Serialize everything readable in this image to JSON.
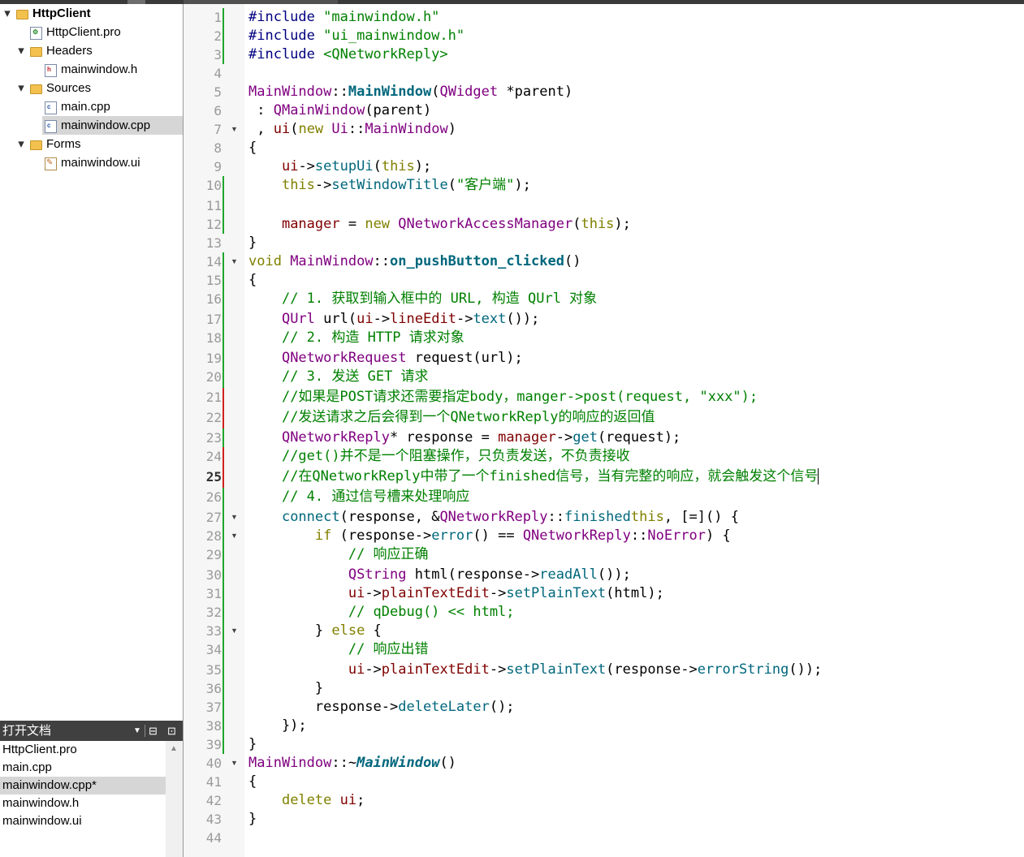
{
  "project_tree": [
    {
      "label": "HttpClient",
      "indent": 0,
      "arrow": "down",
      "icon": "project",
      "bold": true
    },
    {
      "label": "HttpClient.pro",
      "indent": 1,
      "arrow": "",
      "icon": "pro-file"
    },
    {
      "label": "Headers",
      "indent": 1,
      "arrow": "down",
      "icon": "folder"
    },
    {
      "label": "mainwindow.h",
      "indent": 2,
      "arrow": "",
      "icon": "header-file"
    },
    {
      "label": "Sources",
      "indent": 1,
      "arrow": "down",
      "icon": "folder"
    },
    {
      "label": "main.cpp",
      "indent": 2,
      "arrow": "",
      "icon": "cpp-file"
    },
    {
      "label": "mainwindow.cpp",
      "indent": 2,
      "arrow": "",
      "icon": "cpp-file",
      "selected": true
    },
    {
      "label": "Forms",
      "indent": 1,
      "arrow": "down",
      "icon": "folder"
    },
    {
      "label": "mainwindow.ui",
      "indent": 2,
      "arrow": "",
      "icon": "ui-file"
    }
  ],
  "open_documents": {
    "title": "打开文档",
    "items": [
      "HttpClient.pro",
      "main.cpp",
      "mainwindow.cpp*",
      "mainwindow.h",
      "mainwindow.ui"
    ],
    "selected_index": 2
  },
  "editor": {
    "current_line": 25,
    "lines": [
      {
        "n": "1",
        "tokens": [
          [
            "pp",
            "#include "
          ],
          [
            "s",
            "\"mainwindow.h\""
          ]
        ],
        "chg": "green"
      },
      {
        "n": "2",
        "tokens": [
          [
            "pp",
            "#include "
          ],
          [
            "s",
            "\"ui_mainwindow.h\""
          ]
        ],
        "chg": "green"
      },
      {
        "n": "3",
        "tokens": [
          [
            "pp",
            "#include "
          ],
          [
            "s",
            "<QNetworkReply>"
          ]
        ],
        "chg": "green"
      },
      {
        "n": "4",
        "tokens": []
      },
      {
        "n": "5",
        "tokens": [
          [
            "t",
            "MainWindow"
          ],
          [
            "",
            "::"
          ],
          [
            "fb",
            "MainWindow"
          ],
          [
            "",
            "("
          ],
          [
            "t",
            "QWidget"
          ],
          [
            "",
            " *parent)"
          ]
        ]
      },
      {
        "n": "6",
        "tokens": [
          [
            "",
            " : "
          ],
          [
            "t",
            "QMainWindow"
          ],
          [
            "",
            "(parent)"
          ]
        ]
      },
      {
        "n": "7",
        "tokens": [
          [
            "",
            " , "
          ],
          [
            "m",
            "ui"
          ],
          [
            "",
            "("
          ],
          [
            "k",
            "new "
          ],
          [
            "t",
            "Ui"
          ],
          [
            "",
            "::"
          ],
          [
            "t",
            "MainWindow"
          ],
          [
            "",
            ")"
          ]
        ],
        "fold": true
      },
      {
        "n": "8",
        "tokens": [
          [
            "",
            "{"
          ]
        ]
      },
      {
        "n": "9",
        "tokens": [
          [
            "",
            "    "
          ],
          [
            "m",
            "ui"
          ],
          [
            "",
            "->"
          ],
          [
            "f",
            "setupUi"
          ],
          [
            "",
            "("
          ],
          [
            "k",
            "this"
          ],
          [
            "",
            ");"
          ]
        ]
      },
      {
        "n": "10",
        "tokens": [
          [
            "",
            "    "
          ],
          [
            "k",
            "this"
          ],
          [
            "",
            "->"
          ],
          [
            "f",
            "setWindowTitle"
          ],
          [
            "",
            "("
          ],
          [
            "s",
            "\"客户端\""
          ],
          [
            "",
            ");"
          ]
        ],
        "chg": "green"
      },
      {
        "n": "11",
        "tokens": [],
        "chg": "green"
      },
      {
        "n": "12",
        "tokens": [
          [
            "",
            "    "
          ],
          [
            "m",
            "manager"
          ],
          [
            "",
            " = "
          ],
          [
            "k",
            "new "
          ],
          [
            "t",
            "QNetworkAccessManager"
          ],
          [
            "",
            "("
          ],
          [
            "k",
            "this"
          ],
          [
            "",
            ");"
          ]
        ],
        "chg": "green"
      },
      {
        "n": "13",
        "tokens": [
          [
            "",
            "}"
          ]
        ]
      },
      {
        "n": "14",
        "tokens": [
          [
            "k",
            "void "
          ],
          [
            "t",
            "MainWindow"
          ],
          [
            "",
            "::"
          ],
          [
            "fb",
            "on_pushButton_clicked"
          ],
          [
            "",
            "()"
          ]
        ],
        "fold": true,
        "chg": "green"
      },
      {
        "n": "15",
        "tokens": [
          [
            "",
            "{"
          ]
        ],
        "chg": "green"
      },
      {
        "n": "16",
        "tokens": [
          [
            "",
            "    "
          ],
          [
            "c",
            "// 1. 获取到输入框中的 URL, 构造 QUrl 对象"
          ]
        ],
        "chg": "green"
      },
      {
        "n": "17",
        "tokens": [
          [
            "",
            "    "
          ],
          [
            "t",
            "QUrl"
          ],
          [
            "",
            " url("
          ],
          [
            "m",
            "ui"
          ],
          [
            "",
            "->"
          ],
          [
            "m",
            "lineEdit"
          ],
          [
            "",
            "->"
          ],
          [
            "f",
            "text"
          ],
          [
            "",
            "());"
          ]
        ],
        "chg": "green"
      },
      {
        "n": "18",
        "tokens": [
          [
            "",
            "    "
          ],
          [
            "c",
            "// 2. 构造 HTTP 请求对象"
          ]
        ],
        "chg": "green"
      },
      {
        "n": "19",
        "tokens": [
          [
            "",
            "    "
          ],
          [
            "t",
            "QNetworkRequest"
          ],
          [
            "",
            " request(url);"
          ]
        ],
        "chg": "green"
      },
      {
        "n": "20",
        "tokens": [
          [
            "",
            "    "
          ],
          [
            "c",
            "// 3. 发送 GET 请求"
          ]
        ],
        "chg": "green"
      },
      {
        "n": "21",
        "tokens": [
          [
            "",
            "    "
          ],
          [
            "c",
            "//如果是POST请求还需要指定body，manger->post(request, \"xxx\");"
          ]
        ],
        "chg": "red"
      },
      {
        "n": "22",
        "tokens": [
          [
            "",
            "    "
          ],
          [
            "c",
            "//发送请求之后会得到一个QNetworkReply的响应的返回值"
          ]
        ],
        "chg": "red"
      },
      {
        "n": "23",
        "tokens": [
          [
            "",
            "    "
          ],
          [
            "t",
            "QNetworkReply"
          ],
          [
            "",
            "* response = "
          ],
          [
            "m",
            "manager"
          ],
          [
            "",
            "->"
          ],
          [
            "f",
            "get"
          ],
          [
            "",
            "(request);"
          ]
        ],
        "chg": "green"
      },
      {
        "n": "24",
        "tokens": [
          [
            "",
            "    "
          ],
          [
            "c",
            "//get()并不是一个阻塞操作，只负责发送，不负责接收"
          ]
        ],
        "chg": "red"
      },
      {
        "n": "25",
        "tokens": [
          [
            "",
            "    "
          ],
          [
            "c",
            "//在QNetworkReply中带了一个finished信号，当有完整的响应，就会触发这个信号"
          ]
        ],
        "chg": "red",
        "cursor": true
      },
      {
        "n": "26",
        "tokens": [
          [
            "",
            "    "
          ],
          [
            "c",
            "// 4. 通过信号槽来处理响应"
          ]
        ],
        "chg": "green"
      },
      {
        "n": "27",
        "tokens": [
          [
            "",
            "    "
          ],
          [
            "f",
            "connect"
          ],
          [
            "",
            "(response, &"
          ],
          [
            "t",
            "QNetworkReply"
          ],
          [
            "",
            "::"
          ],
          [
            "f",
            "finished"
          ],
          [
            ", "
          ],
          [
            "k",
            "this"
          ],
          [
            "",
            ", [=]() {"
          ]
        ],
        "fold": true,
        "chg": "green"
      },
      {
        "n": "28",
        "tokens": [
          [
            "",
            "        "
          ],
          [
            "k",
            "if"
          ],
          [
            "",
            " (response->"
          ],
          [
            "f",
            "error"
          ],
          [
            "",
            "() == "
          ],
          [
            "t",
            "QNetworkReply"
          ],
          [
            "",
            "::"
          ],
          [
            "t",
            "NoError"
          ],
          [
            "",
            ") {"
          ]
        ],
        "fold": true,
        "chg": "green"
      },
      {
        "n": "29",
        "tokens": [
          [
            "",
            "            "
          ],
          [
            "c",
            "// 响应正确"
          ]
        ],
        "chg": "green"
      },
      {
        "n": "30",
        "tokens": [
          [
            "",
            "            "
          ],
          [
            "t",
            "QString"
          ],
          [
            "",
            " html(response->"
          ],
          [
            "f",
            "readAll"
          ],
          [
            "",
            "());"
          ]
        ],
        "chg": "green"
      },
      {
        "n": "31",
        "tokens": [
          [
            "",
            "            "
          ],
          [
            "m",
            "ui"
          ],
          [
            "",
            "->"
          ],
          [
            "m",
            "plainTextEdit"
          ],
          [
            "",
            "->"
          ],
          [
            "f",
            "setPlainText"
          ],
          [
            "",
            "(html);"
          ]
        ],
        "chg": "green"
      },
      {
        "n": "32",
        "tokens": [
          [
            "",
            "            "
          ],
          [
            "c",
            "// qDebug() << html;"
          ]
        ],
        "chg": "green"
      },
      {
        "n": "33",
        "tokens": [
          [
            "",
            "        } "
          ],
          [
            "k",
            "else"
          ],
          [
            "",
            " {"
          ]
        ],
        "fold": true,
        "chg": "green"
      },
      {
        "n": "34",
        "tokens": [
          [
            "",
            "            "
          ],
          [
            "c",
            "// 响应出错"
          ]
        ],
        "chg": "green"
      },
      {
        "n": "35",
        "tokens": [
          [
            "",
            "            "
          ],
          [
            "m",
            "ui"
          ],
          [
            "",
            "->"
          ],
          [
            "m",
            "plainTextEdit"
          ],
          [
            "",
            "->"
          ],
          [
            "f",
            "setPlainText"
          ],
          [
            "",
            "(response->"
          ],
          [
            "f",
            "errorString"
          ],
          [
            "",
            "());"
          ]
        ],
        "chg": "green"
      },
      {
        "n": "36",
        "tokens": [
          [
            "",
            "        }"
          ]
        ],
        "chg": "green"
      },
      {
        "n": "37",
        "tokens": [
          [
            "",
            "        response->"
          ],
          [
            "f",
            "deleteLater"
          ],
          [
            "",
            "();"
          ]
        ],
        "chg": "green"
      },
      {
        "n": "38",
        "tokens": [
          [
            "",
            "    });"
          ]
        ],
        "chg": "green"
      },
      {
        "n": "39",
        "tokens": [
          [
            "",
            "}"
          ]
        ],
        "chg": "green"
      },
      {
        "n": "40",
        "tokens": [
          [
            "t",
            "MainWindow"
          ],
          [
            "",
            "::~"
          ],
          [
            "fi",
            "MainWindow"
          ],
          [
            "",
            "()"
          ]
        ],
        "fold": true
      },
      {
        "n": "41",
        "tokens": [
          [
            "",
            "{"
          ]
        ]
      },
      {
        "n": "42",
        "tokens": [
          [
            "",
            "    "
          ],
          [
            "k",
            "delete "
          ],
          [
            "m",
            "ui"
          ],
          [
            "",
            ";"
          ]
        ]
      },
      {
        "n": "43",
        "tokens": [
          [
            "",
            "}"
          ]
        ]
      },
      {
        "n": "44",
        "tokens": []
      }
    ]
  },
  "colors": {
    "keyword": "#808000",
    "type": "#800080",
    "string": "#008000",
    "comment": "#008000",
    "function": "#00677c",
    "member": "#800000",
    "preprocessor": "#000080",
    "change_saved": "#1fa52c",
    "change_unsaved": "#d02020"
  }
}
